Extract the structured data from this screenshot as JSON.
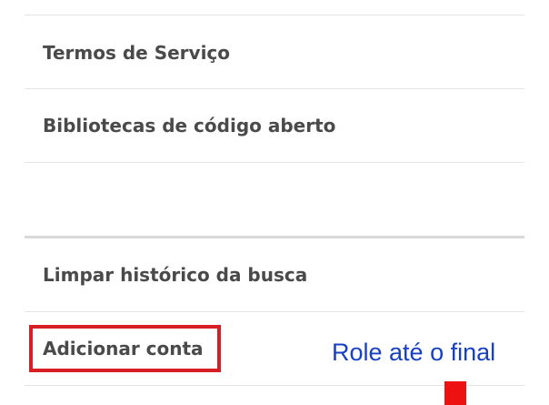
{
  "menu": {
    "items": [
      {
        "label": "Termos de Serviço"
      },
      {
        "label": "Bibliotecas de código aberto"
      },
      {
        "label": "Limpar histórico da busca"
      },
      {
        "label": "Adicionar conta"
      }
    ]
  },
  "annotation": {
    "instruction": "Role até o final",
    "highlight_color": "#d81f26",
    "text_color": "#1740c2",
    "marker_color": "#ee1111"
  }
}
